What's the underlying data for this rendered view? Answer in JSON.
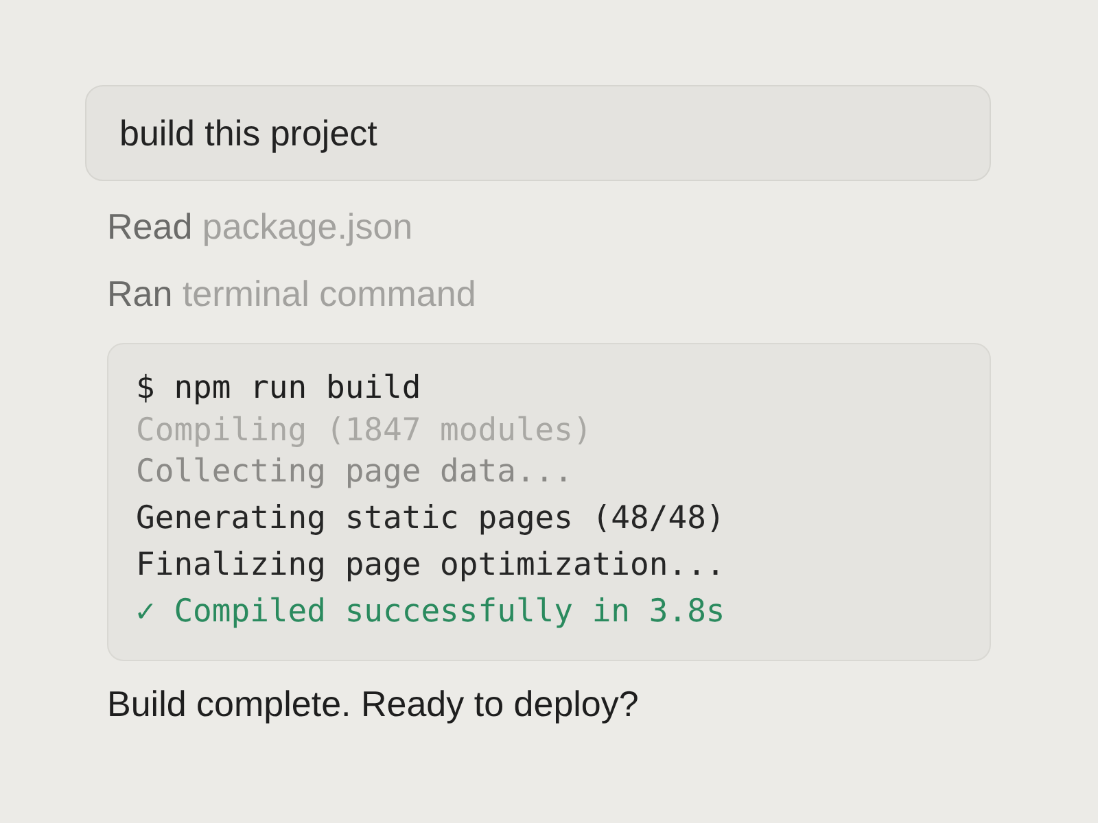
{
  "prompt": {
    "text": "build this project"
  },
  "steps": [
    {
      "verb": "Read",
      "object": "package.json"
    },
    {
      "verb": "Ran",
      "object": "terminal command"
    }
  ],
  "terminal": {
    "command": "$ npm run build",
    "lines": [
      {
        "kind": "faint",
        "text": "Compiling (1847 modules)"
      },
      {
        "kind": "dim",
        "text": "Collecting page data..."
      },
      {
        "kind": "normal",
        "text": "Generating static pages (48/48)"
      },
      {
        "kind": "normal",
        "text": "Finalizing page optimization..."
      },
      {
        "kind": "success",
        "text": "✓ Compiled successfully in 3.8s"
      }
    ]
  },
  "reply": "Build complete. Ready to deploy?"
}
